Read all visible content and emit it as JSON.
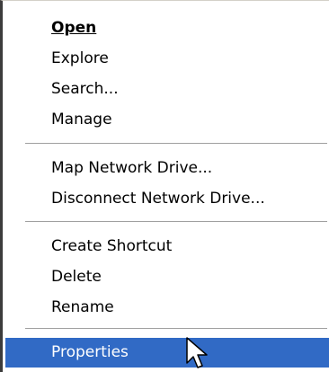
{
  "menu": {
    "items": [
      {
        "label": "Open",
        "bold": true
      },
      {
        "label": "Explore"
      },
      {
        "label": "Search..."
      },
      {
        "label": "Manage"
      },
      {
        "label": "Map Network Drive..."
      },
      {
        "label": "Disconnect Network Drive..."
      },
      {
        "label": "Create Shortcut"
      },
      {
        "label": "Delete"
      },
      {
        "label": "Rename"
      },
      {
        "label": "Properties",
        "highlighted": true
      }
    ]
  },
  "cursor": {
    "icon": "arrow-pointer-icon"
  },
  "colors": {
    "highlight": "#316ac5",
    "highlight_text": "#ffffff",
    "separator": "#a0a0a0"
  }
}
